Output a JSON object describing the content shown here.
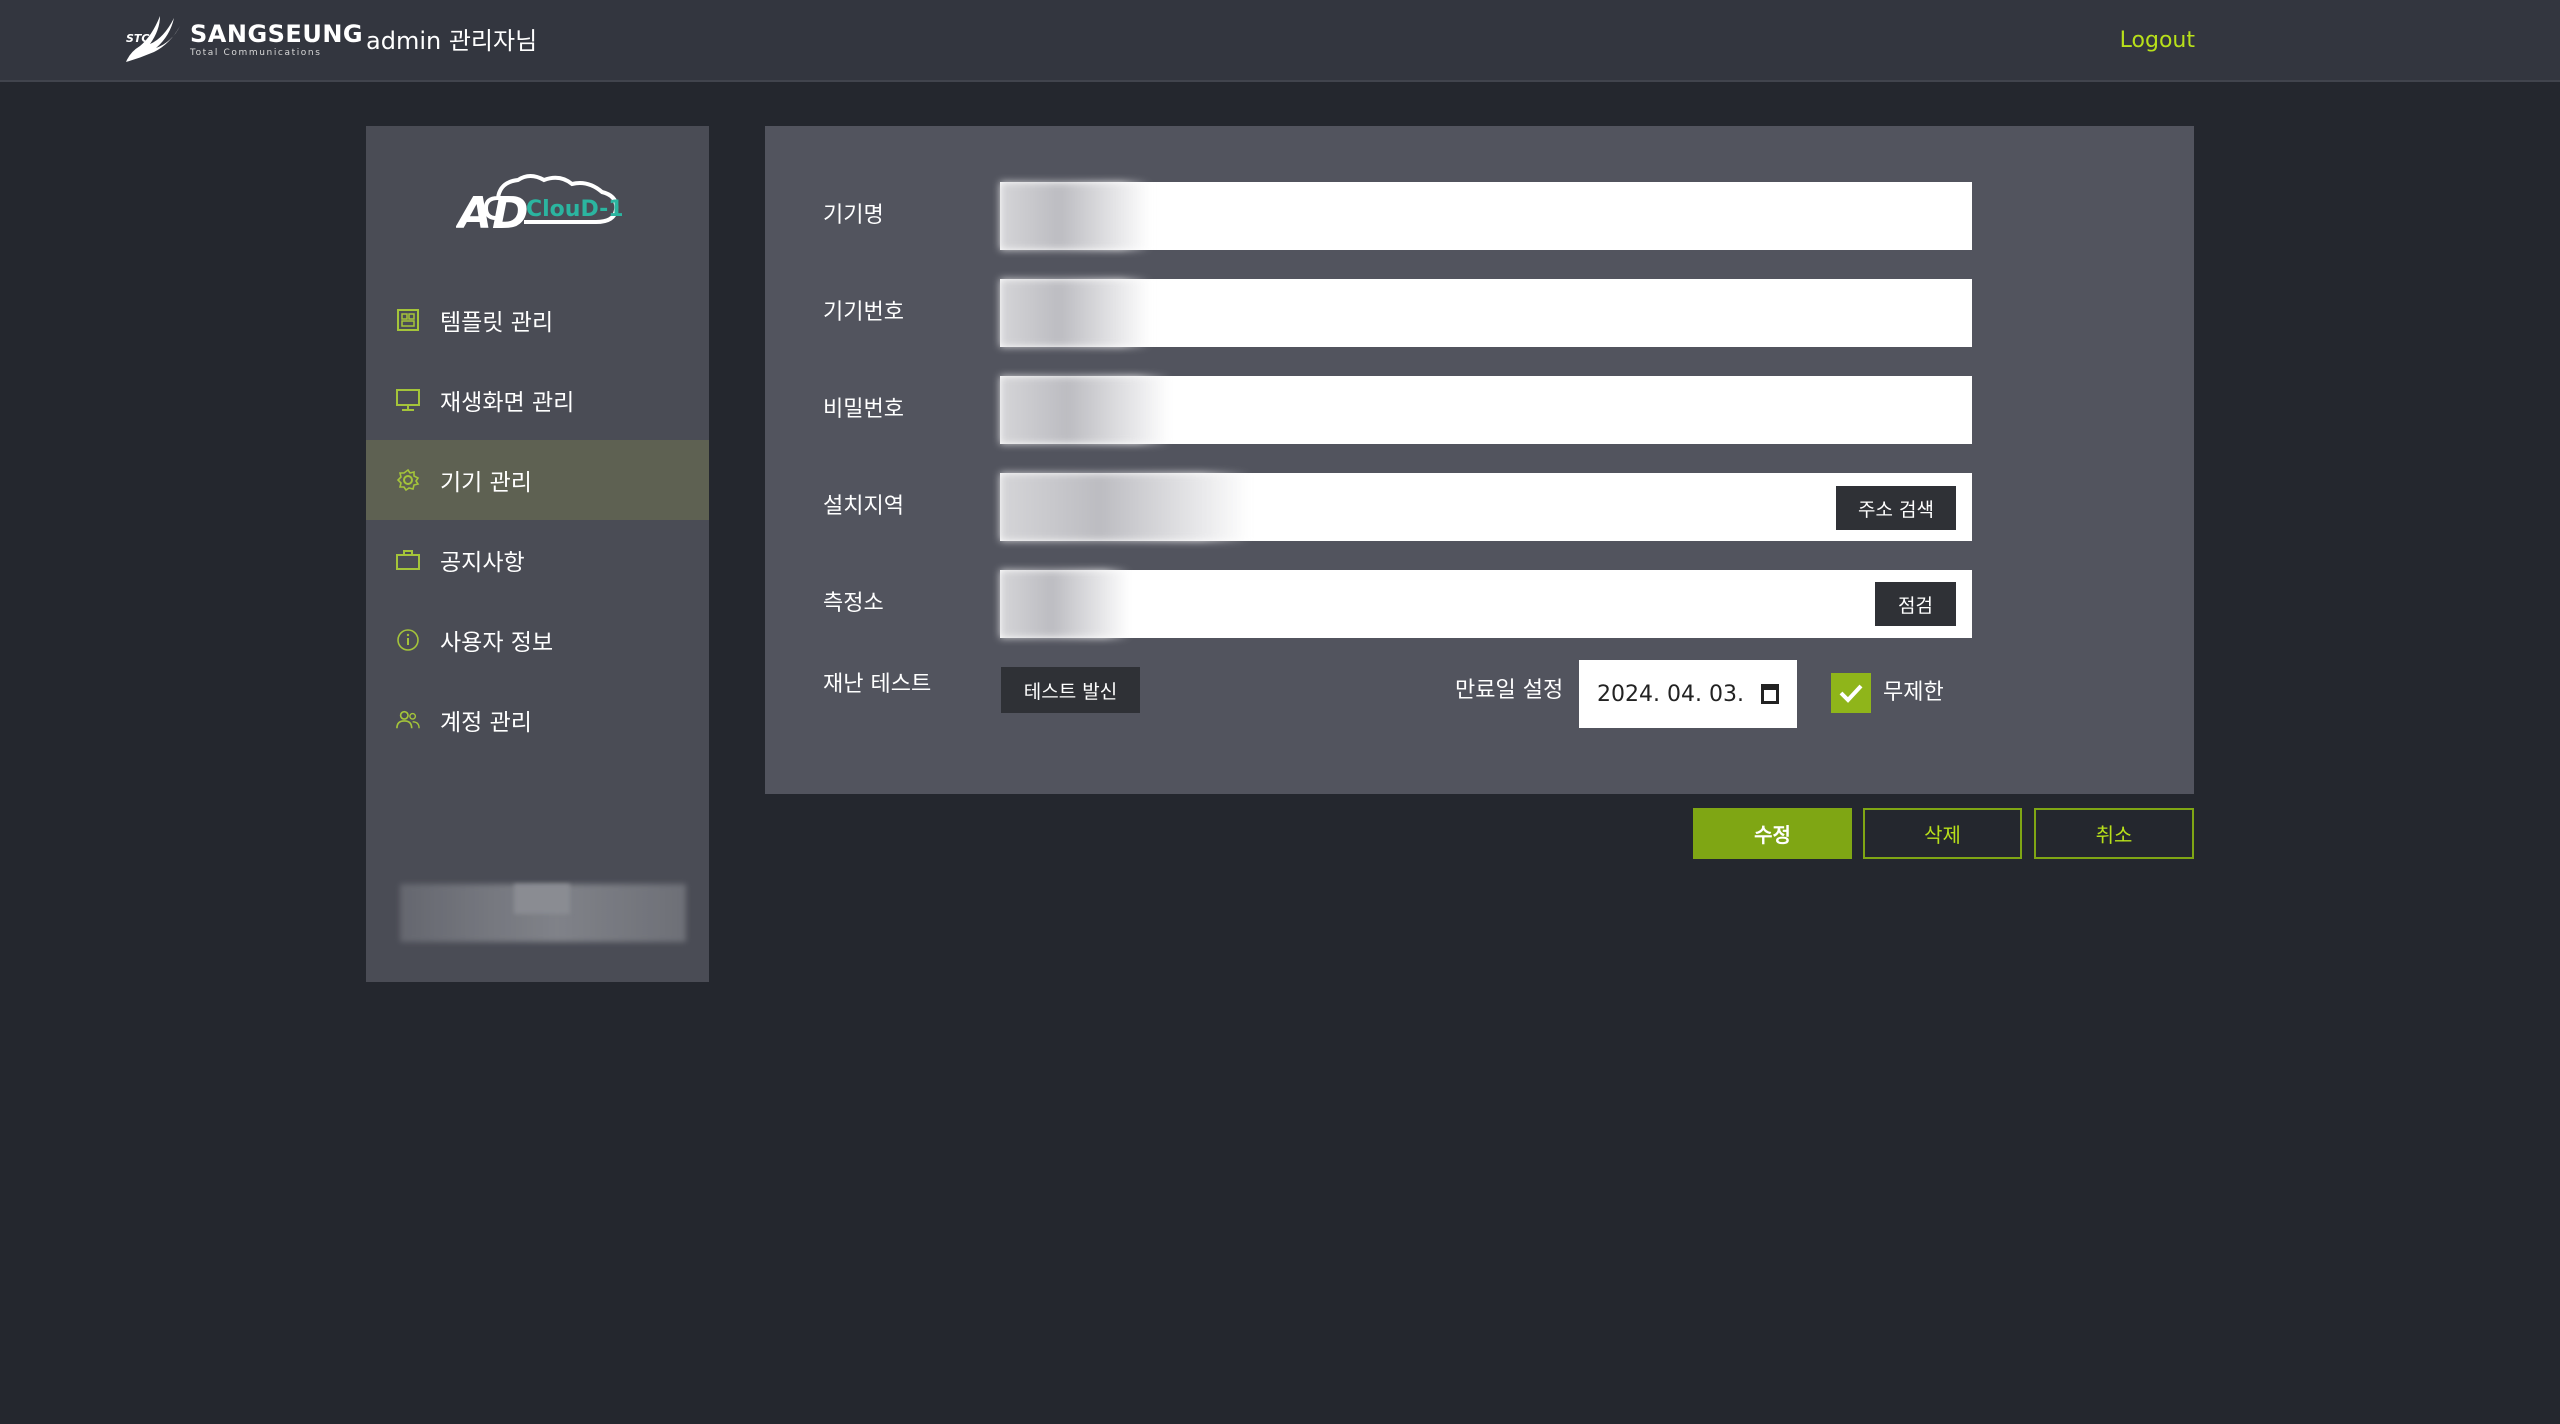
{
  "header": {
    "brand_name": "SANGSEUNG",
    "brand_sub": "Total Communications",
    "brand_mark": "STC",
    "admin_title": "admin 관리자님",
    "logout_label": "Logout"
  },
  "sidebar": {
    "logo_text": "AD",
    "logo_sub": "ClouD-1",
    "items": [
      {
        "label": "템플릿 관리",
        "icon": "template-icon",
        "active": false
      },
      {
        "label": "재생화면 관리",
        "icon": "monitor-icon",
        "active": false
      },
      {
        "label": "기기 관리",
        "icon": "gear-icon",
        "active": true
      },
      {
        "label": "공지사항",
        "icon": "briefcase-icon",
        "active": false
      },
      {
        "label": "사용자 정보",
        "icon": "info-icon",
        "active": false
      },
      {
        "label": "계정 관리",
        "icon": "users-icon",
        "active": false
      }
    ]
  },
  "form": {
    "device_name_label": "기기명",
    "device_number_label": "기기번호",
    "password_label": "비밀번호",
    "location_label": "설치지역",
    "address_search_label": "주소 검색",
    "station_label": "측정소",
    "check_label": "점검",
    "disaster_test_label": "재난 테스트",
    "send_test_label": "테스트 발신",
    "expiry_label": "만료일 설정",
    "expiry_value": "2024. 04. 03.",
    "unlimited_label": "무제한",
    "unlimited_checked": true
  },
  "actions": {
    "edit_label": "수정",
    "delete_label": "삭제",
    "cancel_label": "취소"
  },
  "colors": {
    "accent": "#7fa614",
    "accent_text": "#b8e01a",
    "background": "#24272e",
    "panel": "#52545e",
    "sidebar": "#4a4c55"
  }
}
